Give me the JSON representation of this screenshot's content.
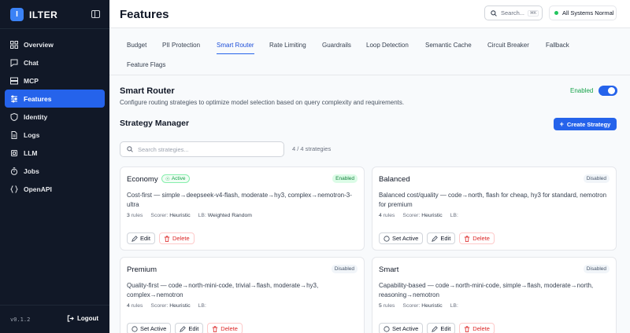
{
  "brand": {
    "logo_letter": "I",
    "name": "ILTER"
  },
  "sidebar": {
    "items": [
      {
        "label": "Overview",
        "icon": "grid-icon"
      },
      {
        "label": "Chat",
        "icon": "chat-icon"
      },
      {
        "label": "MCP",
        "icon": "server-icon"
      },
      {
        "label": "Features",
        "icon": "sliders-icon",
        "active": true
      },
      {
        "label": "Identity",
        "icon": "shield-icon"
      },
      {
        "label": "Logs",
        "icon": "document-icon"
      },
      {
        "label": "LLM",
        "icon": "chip-icon"
      },
      {
        "label": "Jobs",
        "icon": "timer-icon"
      },
      {
        "label": "OpenAPI",
        "icon": "braces-icon"
      }
    ],
    "version": "v0.1.2",
    "logout_label": "Logout"
  },
  "header": {
    "title": "Features",
    "search_placeholder": "Search...",
    "search_shortcut": "⌘K",
    "status_text": "All Systems Normal",
    "status_color": "#22c55e"
  },
  "tabs": [
    {
      "label": "Budget"
    },
    {
      "label": "PII Protection"
    },
    {
      "label": "Smart Router",
      "active": true
    },
    {
      "label": "Rate Limiting"
    },
    {
      "label": "Guardrails"
    },
    {
      "label": "Loop Detection"
    },
    {
      "label": "Semantic Cache"
    },
    {
      "label": "Circuit Breaker"
    },
    {
      "label": "Fallback"
    },
    {
      "label": "Feature Flags"
    }
  ],
  "section": {
    "title": "Smart Router",
    "description": "Configure routing strategies to optimize model selection based on query complexity and requirements.",
    "enabled_label": "Enabled",
    "enabled": true
  },
  "manager": {
    "title": "Strategy Manager",
    "create_label": "Create Strategy",
    "search_placeholder": "Search strategies...",
    "count_text": "4 / 4 strategies"
  },
  "labels": {
    "rules_suffix": "rules",
    "scorer_prefix": "Scorer:",
    "lb_prefix": "LB:",
    "edit": "Edit",
    "delete": "Delete",
    "set_active": "Set Active",
    "active_badge": "Active"
  },
  "strategies": [
    {
      "name": "Economy",
      "is_active": true,
      "state": "Enabled",
      "description": "Cost-first — simple→deepseek-v4-flash, moderate→hy3, complex→nemotron-3-ultra",
      "rules": "3",
      "scorer": "Heuristic",
      "lb": "Weighted Random"
    },
    {
      "name": "Balanced",
      "is_active": false,
      "state": "Disabled",
      "description": "Balanced cost/quality — code→north, flash for cheap, hy3 for standard, nemotron for premium",
      "rules": "4",
      "scorer": "Heuristic",
      "lb": ""
    },
    {
      "name": "Premium",
      "is_active": false,
      "state": "Disabled",
      "description": "Quality-first — code→north-mini-code, trivial→flash, moderate→hy3, complex→nemotron",
      "rules": "4",
      "scorer": "Heuristic",
      "lb": ""
    },
    {
      "name": "Smart",
      "is_active": false,
      "state": "Disabled",
      "description": "Capability-based — code→north-mini-code, simple→flash, moderate→north, reasoning→nemotron",
      "rules": "5",
      "scorer": "Heuristic",
      "lb": ""
    }
  ]
}
